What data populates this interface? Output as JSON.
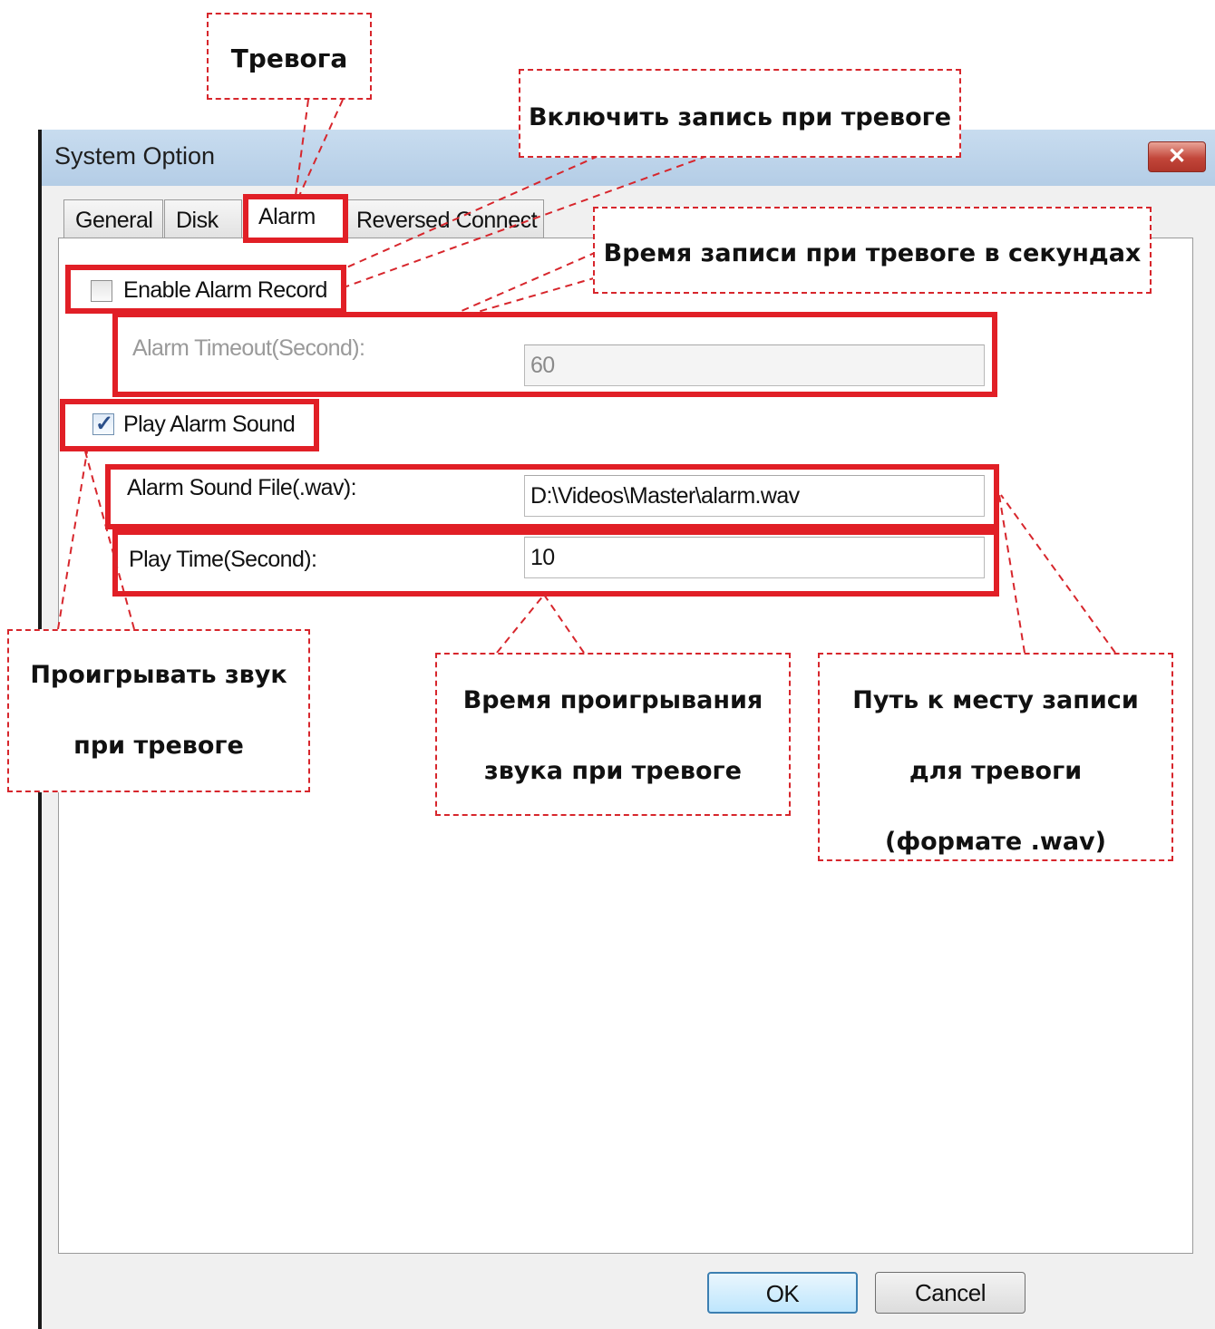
{
  "window": {
    "title": "System Option",
    "close_glyph": "✕"
  },
  "tabs": [
    {
      "label": "General",
      "active": false
    },
    {
      "label": "Disk",
      "active": false
    },
    {
      "label": "Alarm",
      "active": true
    },
    {
      "label": "Reversed Connect",
      "active": false
    }
  ],
  "alarm": {
    "enable_record_label": "Enable Alarm Record",
    "enable_record_checked": false,
    "timeout_label": "Alarm Timeout(Second):",
    "timeout_value": "60",
    "play_sound_label": "Play Alarm Sound",
    "play_sound_checked": true,
    "sound_file_label": "Alarm Sound File(.wav):",
    "sound_file_value": "D:\\Videos\\Master\\alarm.wav",
    "play_time_label": "Play Time(Second):",
    "play_time_value": "10"
  },
  "buttons": {
    "ok": "OK",
    "cancel": "Cancel"
  },
  "annotations": {
    "alarm_tab": "Тревога",
    "enable_record": "Включить запись при тревоге",
    "timeout": "Время записи при тревоге в секундах",
    "play_sound": [
      "Проигрывать звук",
      "при тревоге"
    ],
    "play_time": [
      "Время проигрывания",
      "звука при тревоге"
    ],
    "sound_path": [
      "Путь к месту записи",
      "для тревоги",
      "(формате .wav)"
    ],
    "highlight_color": "#e11f26",
    "dash_color": "#d7262c"
  }
}
